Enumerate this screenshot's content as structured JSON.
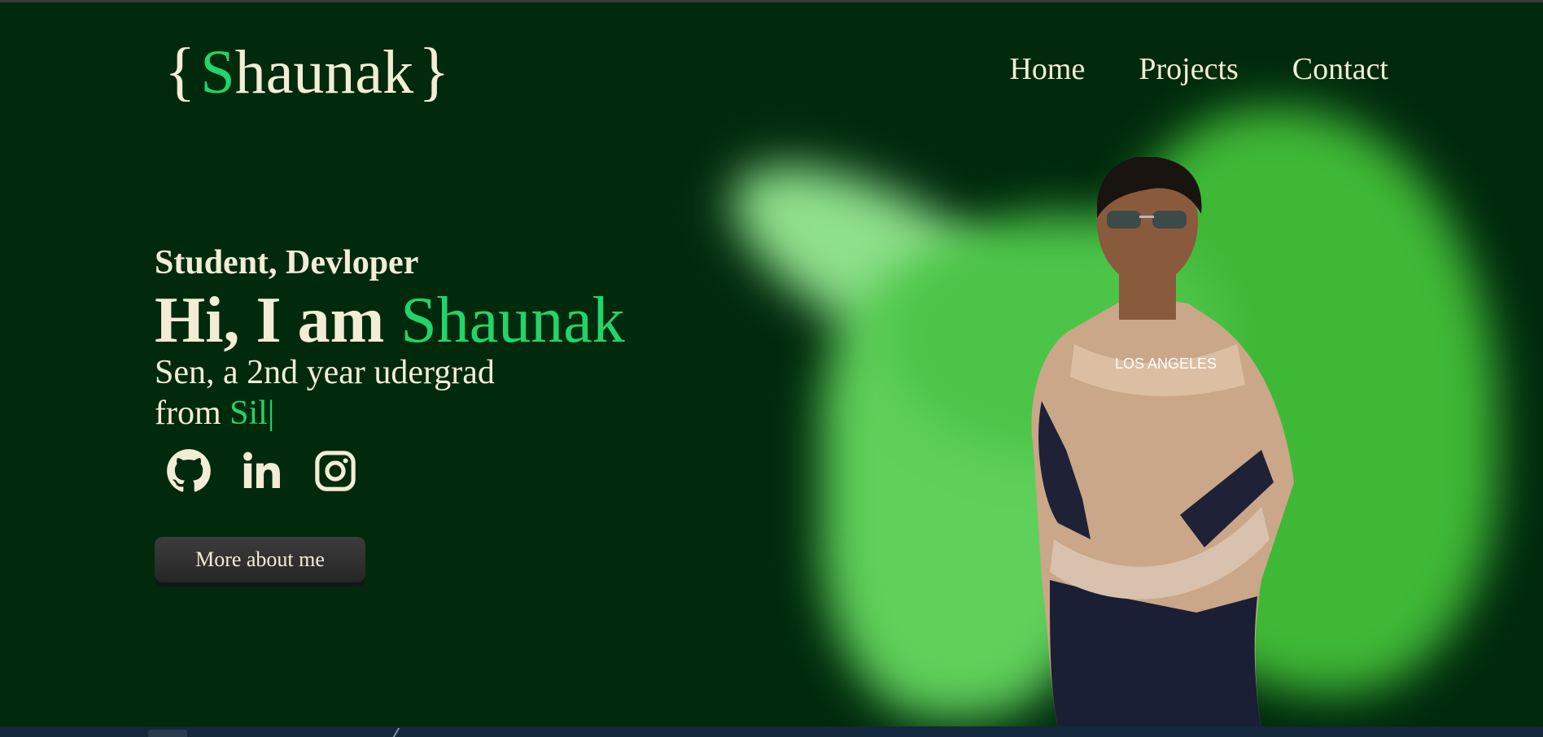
{
  "logo": {
    "open_brace": "{",
    "initial": "S",
    "rest": "haunak",
    "close_brace": "}"
  },
  "nav": {
    "items": [
      "Home",
      "Projects",
      "Contact"
    ]
  },
  "hero": {
    "subtitle": "Student, Devloper",
    "greeting": "Hi, I am",
    "name": "Shaunak",
    "line1": "Sen, a 2nd year udergrad",
    "line2_prefix": "from",
    "typed": "Sil",
    "cursor": "|",
    "button": "More about me"
  },
  "socials": [
    "github-icon",
    "linkedin-icon",
    "instagram-icon"
  ],
  "colors": {
    "background": "#012a0d",
    "accent": "#22d46a",
    "text": "#f3ecd6",
    "glow": "#4cc448"
  }
}
